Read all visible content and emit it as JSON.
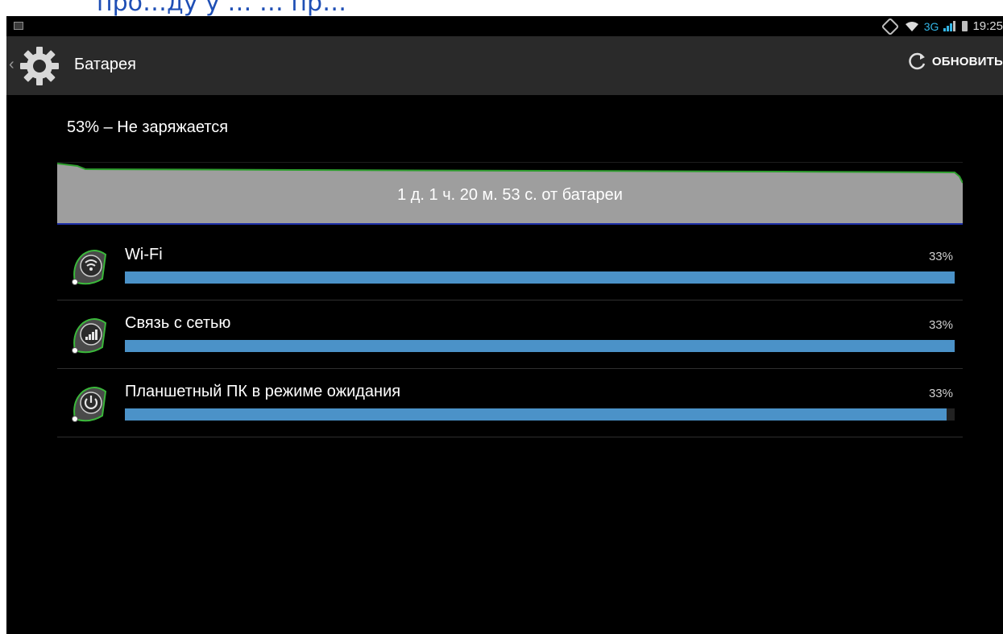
{
  "caption": {
    "text": "про…ду у … … пр…"
  },
  "status_bar": {
    "network_type": "3G",
    "time": "19:25",
    "icons": [
      "picture-icon",
      "screen-rotation-icon",
      "wifi-icon",
      "signal-icon",
      "battery-icon"
    ]
  },
  "action_bar": {
    "title": "Батарея",
    "refresh_label": "ОБНОВИТЬ",
    "icons": [
      "back-chevron-icon",
      "settings-gear-icon",
      "refresh-icon"
    ]
  },
  "battery": {
    "summary": "53% – Не заряжается",
    "time_on_battery": "1 д. 1 ч. 20 м. 53 с. от батареи",
    "level_percent": 53
  },
  "usage": [
    {
      "label": "Wi-Fi",
      "percent_text": "33%",
      "fill_fraction": 1.0,
      "icon": "wifi-icon"
    },
    {
      "label": "Связь с сетью",
      "percent_text": "33%",
      "fill_fraction": 1.0,
      "icon": "signal-icon"
    },
    {
      "label": "Планшетный ПК в режиме ожидания",
      "percent_text": "33%",
      "fill_fraction": 0.99,
      "icon": "power-icon"
    }
  ],
  "colors": {
    "background": "#000000",
    "action_bar": "#2a2a2a",
    "bar_fill": "#4b92c8",
    "chart_fill": "#9e9e9e",
    "chart_line": "#2e9e2e",
    "accent": "#33b5e5"
  }
}
